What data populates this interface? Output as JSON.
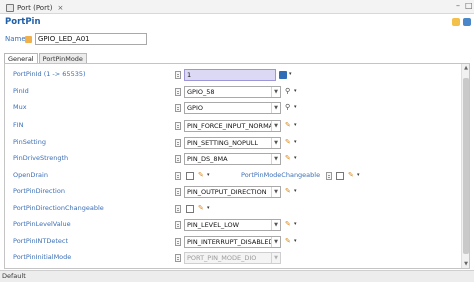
{
  "window": {
    "tab_title": "Port (Port)",
    "close_glyph": "×"
  },
  "header": {
    "title": "PortPin"
  },
  "name": {
    "label": "Name",
    "value": "GPIO_LED_A01"
  },
  "tabs": [
    {
      "label": "General"
    },
    {
      "label": "PortPinMode"
    }
  ],
  "fields": {
    "portpinid": {
      "label": "PortPinId (1 -> 65535)",
      "value": "1"
    },
    "pinid": {
      "label": "PinId",
      "value": "GPIO_58"
    },
    "mux": {
      "label": "Mux",
      "value": "GPIO"
    },
    "fin": {
      "label": "FIN",
      "value": "PIN_FORCE_INPUT_NORMAL"
    },
    "pinsetting": {
      "label": "PinSetting",
      "value": "PIN_SETTING_NOPULL"
    },
    "pindrivestrength": {
      "label": "PinDriveStrength",
      "value": "PIN_DS_8MA"
    },
    "opendrain": {
      "label": "OpenDrain",
      "checked": false
    },
    "modechangeable": {
      "label": "PortPinModeChangeable",
      "checked": false
    },
    "direction": {
      "label": "PortPinDirection",
      "value": "PIN_OUTPUT_DIRECTION"
    },
    "directionchangeable": {
      "label": "PortPinDirectionChangeable",
      "checked": false
    },
    "levelvalue": {
      "label": "PortPinLevelValue",
      "value": "PIN_LEVEL_LOW"
    },
    "intdetect": {
      "label": "PortPinINTDetect",
      "value": "PIN_INTERRUPT_DISABLED"
    },
    "initialmode": {
      "label": "PortPinInitialMode",
      "value": "PORT_PIN_MODE_DIO"
    }
  },
  "glyphs": {
    "dropdown": "▼",
    "caret": "▾",
    "pen": "✎",
    "tree": "⚲",
    "hash": "#"
  },
  "status": {
    "tab_label": "Default"
  },
  "colors": {
    "label_blue": "#3b6fb6",
    "title_blue": "#1f5fa8",
    "highlight": "#dcd9f5",
    "pen_orange": "#d8891f"
  }
}
